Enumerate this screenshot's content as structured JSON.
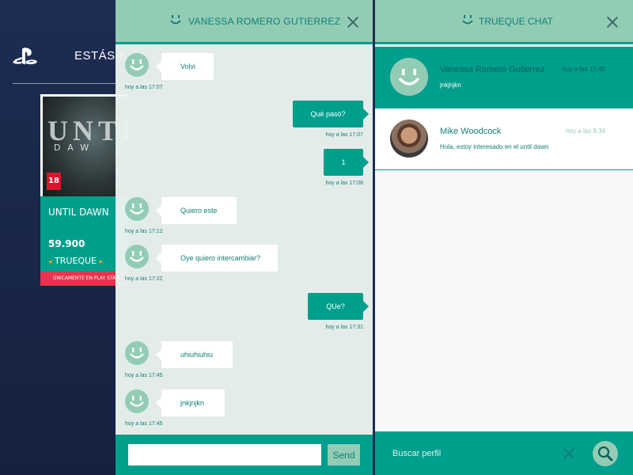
{
  "store": {
    "heading": "ESTÁS E",
    "game": {
      "cover_title": "UNTI",
      "cover_subtitle": "DAW",
      "age_rating": "18",
      "name": "UNTIL DAWN",
      "price": "59.900",
      "mode": "TRUEQUE",
      "ribbon": "ÚNICAMENTE EN PLAY STAT"
    }
  },
  "chat": {
    "title": "VANESSA ROMERO GUTIERREZ",
    "messages": [
      {
        "direction": "in",
        "text": "Volvi",
        "time": "hoy a las 17:07"
      },
      {
        "direction": "out",
        "text": "Qué pasó?",
        "time": "hoy a las 17:07"
      },
      {
        "direction": "out",
        "text": "1",
        "time": "hoy a las 17:08"
      },
      {
        "direction": "in",
        "text": "Quiero este",
        "time": "hoy a las 17:12"
      },
      {
        "direction": "in",
        "text": "Oye quiero intercambiar?",
        "time": "hoy a las 17:22"
      },
      {
        "direction": "out",
        "text": "QUe?",
        "time": "hoy a las 17:31"
      },
      {
        "direction": "in",
        "text": "uhiuhiuhiu",
        "time": "hoy a las 17:45"
      },
      {
        "direction": "in",
        "text": "jnkjnjkn",
        "time": "hoy a las 17:45"
      }
    ],
    "input_placeholder": "",
    "send_label": "Send"
  },
  "list": {
    "title": "TRUEQUE CHAT",
    "conversations": [
      {
        "name": "Vanessa Romero Gutierrez",
        "time": "hoy a las 17:45",
        "preview": "jnkjnjkn",
        "avatar": "smile-icon"
      },
      {
        "name": "Mike Woodcock",
        "time": "hoy a las 9:34",
        "preview": "Hola, estoy interesado en el until dawn",
        "avatar": "user-photo"
      }
    ],
    "search_placeholder": "Buscar perfil"
  },
  "colors": {
    "teal": "#009e8c",
    "mint": "#93ccb5",
    "navy": "#1d2c52",
    "ribbon_red": "#e8324f"
  }
}
